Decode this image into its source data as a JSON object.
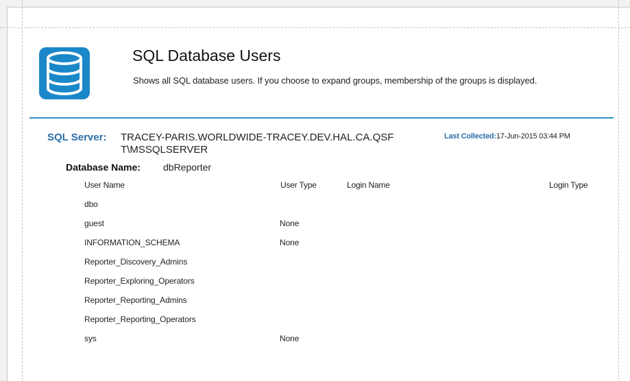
{
  "report": {
    "title": "SQL Database Users",
    "description": "Shows all SQL database users. If you choose to expand groups, membership of the groups is displayed."
  },
  "server": {
    "label": "SQL Server:",
    "value": "TRACEY-PARIS.WORLDWIDE-TRACEY.DEV.HAL.CA.QSFT\\MSSQLSERVER",
    "last_collected_label": "Last Collected:",
    "last_collected_value": "17-Jun-2015 03:44 PM"
  },
  "database": {
    "label": "Database Name:",
    "value": "dbReporter"
  },
  "table": {
    "headers": {
      "user_name": "User Name",
      "user_type": "User Type",
      "login_name": "Login Name",
      "login_type": "Login Type"
    },
    "rows": [
      {
        "user_name": "dbo",
        "user_type": "",
        "login_name": "",
        "login_type": ""
      },
      {
        "user_name": "guest",
        "user_type": "None",
        "login_name": "",
        "login_type": ""
      },
      {
        "user_name": "INFORMATION_SCHEMA",
        "user_type": "None",
        "login_name": "",
        "login_type": ""
      },
      {
        "user_name": "Reporter_Discovery_Admins",
        "user_type": "",
        "login_name": "",
        "login_type": ""
      },
      {
        "user_name": "Reporter_Exploring_Operators",
        "user_type": "",
        "login_name": "",
        "login_type": ""
      },
      {
        "user_name": "Reporter_Reporting_Admins",
        "user_type": "",
        "login_name": "",
        "login_type": ""
      },
      {
        "user_name": "Reporter_Reporting_Operators",
        "user_type": "",
        "login_name": "",
        "login_type": ""
      },
      {
        "user_name": "sys",
        "user_type": "None",
        "login_name": "",
        "login_type": ""
      }
    ]
  },
  "icons": {
    "report_icon": "database-icon"
  },
  "colors": {
    "accent": "#2b8fc5",
    "label_blue": "#2a6eaa",
    "icon_blue": "#1a87c9"
  }
}
